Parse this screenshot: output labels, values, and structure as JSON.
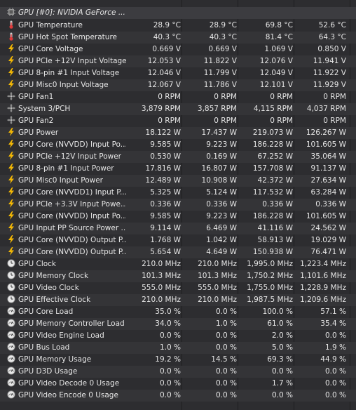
{
  "header": {
    "label": "GPU [#0]: NVIDIA GeForce ...",
    "icon": "chip-icon"
  },
  "rows": [
    {
      "label": "GPU Temperature",
      "icon": "thermometer-icon",
      "current": "28.9 °C",
      "min": "28.9 °C",
      "max": "69.8 °C",
      "avg": "52.6 °C"
    },
    {
      "label": "GPU Hot Spot Temperature",
      "icon": "thermometer-icon",
      "current": "40.3 °C",
      "min": "40.3 °C",
      "max": "81.4 °C",
      "avg": "64.3 °C"
    },
    {
      "label": "GPU Core Voltage",
      "icon": "lightning-icon",
      "current": "0.669 V",
      "min": "0.669 V",
      "max": "1.069 V",
      "avg": "0.850 V"
    },
    {
      "label": "GPU PCIe +12V Input Voltage",
      "icon": "lightning-icon",
      "current": "12.053 V",
      "min": "11.822 V",
      "max": "12.076 V",
      "avg": "11.941 V"
    },
    {
      "label": "GPU 8-pin #1 Input Voltage",
      "icon": "lightning-icon",
      "current": "12.046 V",
      "min": "11.799 V",
      "max": "12.049 V",
      "avg": "11.922 V"
    },
    {
      "label": "GPU Misc0 Input Voltage",
      "icon": "lightning-icon",
      "current": "12.067 V",
      "min": "11.786 V",
      "max": "12.101 V",
      "avg": "11.929 V"
    },
    {
      "label": "GPU Fan1",
      "icon": "fan-icon",
      "current": "0 RPM",
      "min": "0 RPM",
      "max": "0 RPM",
      "avg": "0 RPM"
    },
    {
      "label": "System 3/PCH",
      "icon": "fan-icon",
      "current": "3,879 RPM",
      "min": "3,857 RPM",
      "max": "4,115 RPM",
      "avg": "4,037 RPM"
    },
    {
      "label": "GPU Fan2",
      "icon": "fan-icon",
      "current": "0 RPM",
      "min": "0 RPM",
      "max": "0 RPM",
      "avg": "0 RPM"
    },
    {
      "label": "GPU Power",
      "icon": "lightning-icon",
      "current": "18.122 W",
      "min": "17.437 W",
      "max": "219.073 W",
      "avg": "126.267 W"
    },
    {
      "label": "GPU Core (NVVDD) Input Po...",
      "icon": "lightning-icon",
      "current": "9.585 W",
      "min": "9.223 W",
      "max": "186.228 W",
      "avg": "101.605 W"
    },
    {
      "label": "GPU PCIe +12V Input Power",
      "icon": "lightning-icon",
      "current": "0.530 W",
      "min": "0.169 W",
      "max": "67.252 W",
      "avg": "35.064 W"
    },
    {
      "label": "GPU 8-pin #1 Input Power",
      "icon": "lightning-icon",
      "current": "17.816 W",
      "min": "16.807 W",
      "max": "157.708 W",
      "avg": "91.137 W"
    },
    {
      "label": "GPU Misc0 Input Power",
      "icon": "lightning-icon",
      "current": "12.489 W",
      "min": "10.908 W",
      "max": "42.372 W",
      "avg": "27.634 W"
    },
    {
      "label": "GPU Core (NVVDD1) Input P...",
      "icon": "lightning-icon",
      "current": "5.325 W",
      "min": "5.124 W",
      "max": "117.532 W",
      "avg": "63.284 W"
    },
    {
      "label": "GPU PCIe +3.3V Input Powe...",
      "icon": "lightning-icon",
      "current": "0.336 W",
      "min": "0.336 W",
      "max": "0.336 W",
      "avg": "0.336 W"
    },
    {
      "label": "GPU Core (NVVDD) Input Po...",
      "icon": "lightning-icon",
      "current": "9.585 W",
      "min": "9.223 W",
      "max": "186.228 W",
      "avg": "101.605 W"
    },
    {
      "label": "GPU Input PP Source Power ...",
      "icon": "lightning-icon",
      "current": "9.114 W",
      "min": "6.469 W",
      "max": "41.116 W",
      "avg": "24.562 W"
    },
    {
      "label": "GPU Core (NVVDD) Output P...",
      "icon": "lightning-icon",
      "current": "1.768 W",
      "min": "1.042 W",
      "max": "58.913 W",
      "avg": "19.029 W"
    },
    {
      "label": "GPU Core (NVVDD) Output P...",
      "icon": "lightning-icon",
      "current": "5.654 W",
      "min": "4.649 W",
      "max": "150.938 W",
      "avg": "76.471 W"
    },
    {
      "label": "GPU Clock",
      "icon": "clock-icon",
      "current": "210.0 MHz",
      "min": "210.0 MHz",
      "max": "1,995.0 MHz",
      "avg": "1,223.4 MHz"
    },
    {
      "label": "GPU Memory Clock",
      "icon": "clock-icon",
      "current": "101.3 MHz",
      "min": "101.3 MHz",
      "max": "1,750.2 MHz",
      "avg": "1,101.6 MHz"
    },
    {
      "label": "GPU Video Clock",
      "icon": "clock-icon",
      "current": "555.0 MHz",
      "min": "555.0 MHz",
      "max": "1,755.0 MHz",
      "avg": "1,228.9 MHz"
    },
    {
      "label": "GPU Effective Clock",
      "icon": "clock-icon",
      "current": "210.0 MHz",
      "min": "210.0 MHz",
      "max": "1,987.5 MHz",
      "avg": "1,209.6 MHz"
    },
    {
      "label": "GPU Core Load",
      "icon": "gauge-icon",
      "current": "35.0 %",
      "min": "0.0 %",
      "max": "100.0 %",
      "avg": "57.1 %"
    },
    {
      "label": "GPU Memory Controller Load",
      "icon": "gauge-icon",
      "current": "34.0 %",
      "min": "1.0 %",
      "max": "61.0 %",
      "avg": "35.4 %"
    },
    {
      "label": "GPU Video Engine Load",
      "icon": "gauge-icon",
      "current": "0.0 %",
      "min": "0.0 %",
      "max": "2.0 %",
      "avg": "0.0 %"
    },
    {
      "label": "GPU Bus Load",
      "icon": "gauge-icon",
      "current": "1.0 %",
      "min": "0.0 %",
      "max": "5.0 %",
      "avg": "1.9 %"
    },
    {
      "label": "GPU Memory Usage",
      "icon": "gauge-icon",
      "current": "19.2 %",
      "min": "14.5 %",
      "max": "69.3 %",
      "avg": "44.9 %"
    },
    {
      "label": "GPU D3D Usage",
      "icon": "gauge-icon",
      "current": "0.0 %",
      "min": "0.0 %",
      "max": "0.0 %",
      "avg": "0.0 %"
    },
    {
      "label": "GPU Video Decode 0 Usage",
      "icon": "gauge-icon",
      "current": "0.0 %",
      "min": "0.0 %",
      "max": "1.7 %",
      "avg": "0.0 %"
    },
    {
      "label": "GPU Video Encode 0 Usage",
      "icon": "gauge-icon",
      "current": "0.0 %",
      "min": "0.0 %",
      "max": "0.0 %",
      "avg": "0.0 %"
    }
  ]
}
